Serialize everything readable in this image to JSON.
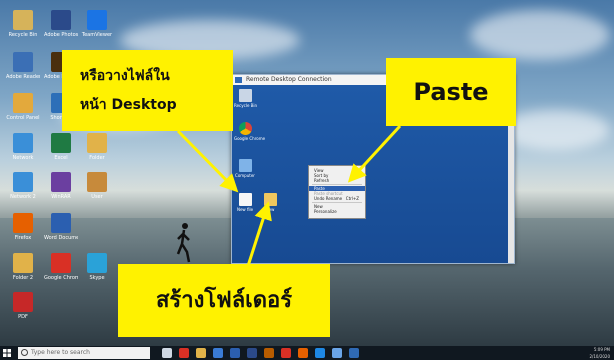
{
  "desktop_icons": [
    {
      "label": "Recycle Bin",
      "icon": "recycle-bin-icon",
      "color": "#d6b35a"
    },
    {
      "label": "Adobe Photoshop",
      "icon": "photoshop-icon",
      "color": "#2b4a8a"
    },
    {
      "label": "TeamViewer",
      "icon": "teamviewer-icon",
      "color": "#1b74e4"
    },
    {
      "label": "Adobe Reader",
      "icon": "adobe-reader-icon",
      "color": "#3b6fb5"
    },
    {
      "label": "Adobe Illustrator",
      "icon": "illustrator-icon",
      "color": "#4a2f0e"
    },
    {
      "label": "Control Panel",
      "icon": "control-panel-icon",
      "color": "#e3a93c"
    },
    {
      "label": "Shortcut",
      "icon": "shortcut-icon",
      "color": "#2d6fb8"
    },
    {
      "label": "Network",
      "icon": "network-icon",
      "color": "#3a8fd8"
    },
    {
      "label": "Excel",
      "icon": "excel-icon",
      "color": "#1f7a43"
    },
    {
      "label": "Folder",
      "icon": "folder-icon",
      "color": "#e1b249"
    },
    {
      "label": "Network 2",
      "icon": "network-icon",
      "color": "#3a8fd8"
    },
    {
      "label": "WinRAR",
      "icon": "winrar-icon",
      "color": "#6b3fa0"
    },
    {
      "label": "User",
      "icon": "user-folder-icon",
      "color": "#c78a3b"
    },
    {
      "label": "Firefox",
      "icon": "firefox-icon",
      "color": "#e66000"
    },
    {
      "label": "Word Document",
      "icon": "word-icon",
      "color": "#2b5fb0"
    },
    {
      "label": "Folder 2",
      "icon": "folder-icon",
      "color": "#e1b249"
    },
    {
      "label": "Google Chrome",
      "icon": "chrome-icon",
      "color": "#d93025"
    },
    {
      "label": "Skype",
      "icon": "skype-icon",
      "color": "#2aa2d8"
    },
    {
      "label": "PDF",
      "icon": "pdf-icon",
      "color": "#c62828"
    }
  ],
  "rdp": {
    "title": "Remote Desktop Connection",
    "icons": [
      {
        "label": "Recycle Bin",
        "icon": "recycle-bin-icon"
      },
      {
        "label": "Google Chrome",
        "icon": "chrome-icon"
      },
      {
        "label": "Computer",
        "icon": "computer-icon"
      },
      {
        "label": "New file",
        "icon": "file-icon"
      },
      {
        "label": "New",
        "icon": "folder-icon"
      }
    ],
    "context_menu": [
      {
        "label": "View",
        "state": "normal"
      },
      {
        "label": "Sort by",
        "state": "normal"
      },
      {
        "label": "Refresh",
        "state": "normal"
      },
      {
        "label": "Paste",
        "state": "highlighted"
      },
      {
        "label": "Paste shortcut",
        "state": "disabled"
      },
      {
        "label": "Undo Rename",
        "state": "normal",
        "shortcut": "Ctrl+Z"
      },
      {
        "label": "New",
        "state": "normal"
      },
      {
        "label": "Personalize",
        "state": "normal"
      }
    ]
  },
  "callouts": {
    "left_line1": "หรือวางไฟล์ใน",
    "left_line2": "หน้า Desktop",
    "right": "Paste",
    "bottom": "สร้างโฟล์เดอร์"
  },
  "taskbar": {
    "search_placeholder": "Type here to search",
    "apps": [
      "task-view-icon",
      "chrome-icon",
      "file-explorer-icon",
      "store-icon",
      "mail-icon",
      "photoshop-icon",
      "illustrator-icon",
      "chrome-icon",
      "firefox-icon",
      "edge-icon",
      "network-icon",
      "remote-desktop-icon"
    ],
    "time": "5:09 PM",
    "date": "2/10/2020"
  },
  "colors": {
    "callout": "#fff200",
    "rdp_desktop": "#1f5aa8",
    "taskbar": "#101820"
  }
}
